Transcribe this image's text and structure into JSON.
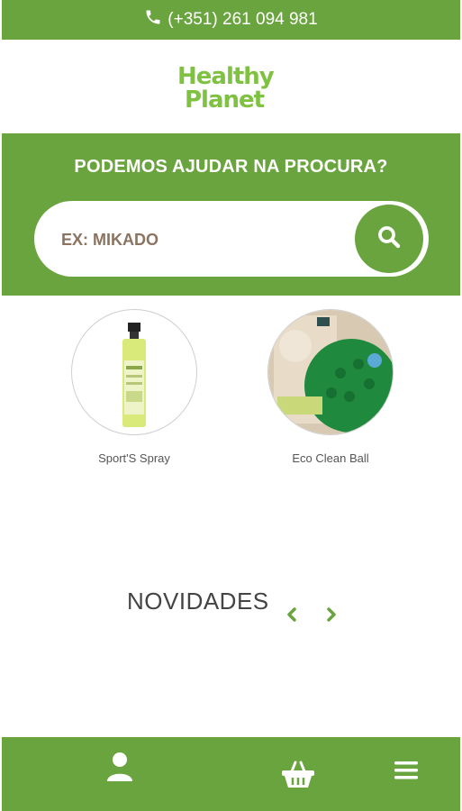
{
  "topbar": {
    "phone": "(+351) 261 094 981",
    "icon": "phone-icon"
  },
  "logo": {
    "line1": "Healthy",
    "line2": "Planet"
  },
  "search": {
    "title": "PODEMOS AJUDAR NA PROCURA?",
    "placeholder": "EX: MIKADO",
    "button_icon": "search-icon"
  },
  "products": [
    {
      "name": "Sport'S Spray"
    },
    {
      "name": "Eco Clean Ball"
    }
  ],
  "novidades": {
    "title": "NOVIDADES"
  },
  "bottom_nav": [
    {
      "icon": "user-icon"
    },
    {
      "icon": "basket-icon"
    },
    {
      "icon": "menu-icon"
    }
  ],
  "colors": {
    "brand_green": "#6aa43f",
    "logo_green": "#7fc241",
    "placeholder": "#8a7361"
  }
}
